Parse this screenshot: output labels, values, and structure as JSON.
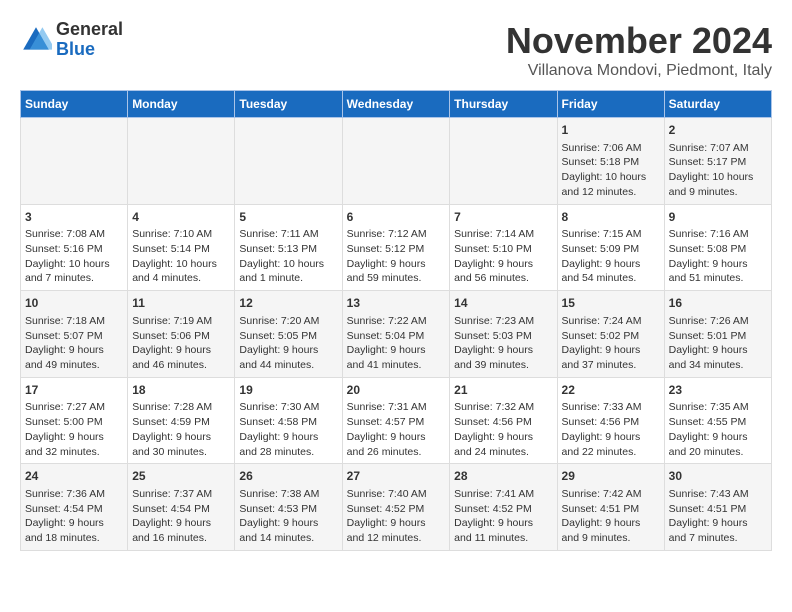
{
  "header": {
    "logo_general": "General",
    "logo_blue": "Blue",
    "month_title": "November 2024",
    "location": "Villanova Mondovi, Piedmont, Italy"
  },
  "days_of_week": [
    "Sunday",
    "Monday",
    "Tuesday",
    "Wednesday",
    "Thursday",
    "Friday",
    "Saturday"
  ],
  "weeks": [
    [
      {
        "day": "",
        "info": ""
      },
      {
        "day": "",
        "info": ""
      },
      {
        "day": "",
        "info": ""
      },
      {
        "day": "",
        "info": ""
      },
      {
        "day": "",
        "info": ""
      },
      {
        "day": "1",
        "info": "Sunrise: 7:06 AM\nSunset: 5:18 PM\nDaylight: 10 hours and 12 minutes."
      },
      {
        "day": "2",
        "info": "Sunrise: 7:07 AM\nSunset: 5:17 PM\nDaylight: 10 hours and 9 minutes."
      }
    ],
    [
      {
        "day": "3",
        "info": "Sunrise: 7:08 AM\nSunset: 5:16 PM\nDaylight: 10 hours and 7 minutes."
      },
      {
        "day": "4",
        "info": "Sunrise: 7:10 AM\nSunset: 5:14 PM\nDaylight: 10 hours and 4 minutes."
      },
      {
        "day": "5",
        "info": "Sunrise: 7:11 AM\nSunset: 5:13 PM\nDaylight: 10 hours and 1 minute."
      },
      {
        "day": "6",
        "info": "Sunrise: 7:12 AM\nSunset: 5:12 PM\nDaylight: 9 hours and 59 minutes."
      },
      {
        "day": "7",
        "info": "Sunrise: 7:14 AM\nSunset: 5:10 PM\nDaylight: 9 hours and 56 minutes."
      },
      {
        "day": "8",
        "info": "Sunrise: 7:15 AM\nSunset: 5:09 PM\nDaylight: 9 hours and 54 minutes."
      },
      {
        "day": "9",
        "info": "Sunrise: 7:16 AM\nSunset: 5:08 PM\nDaylight: 9 hours and 51 minutes."
      }
    ],
    [
      {
        "day": "10",
        "info": "Sunrise: 7:18 AM\nSunset: 5:07 PM\nDaylight: 9 hours and 49 minutes."
      },
      {
        "day": "11",
        "info": "Sunrise: 7:19 AM\nSunset: 5:06 PM\nDaylight: 9 hours and 46 minutes."
      },
      {
        "day": "12",
        "info": "Sunrise: 7:20 AM\nSunset: 5:05 PM\nDaylight: 9 hours and 44 minutes."
      },
      {
        "day": "13",
        "info": "Sunrise: 7:22 AM\nSunset: 5:04 PM\nDaylight: 9 hours and 41 minutes."
      },
      {
        "day": "14",
        "info": "Sunrise: 7:23 AM\nSunset: 5:03 PM\nDaylight: 9 hours and 39 minutes."
      },
      {
        "day": "15",
        "info": "Sunrise: 7:24 AM\nSunset: 5:02 PM\nDaylight: 9 hours and 37 minutes."
      },
      {
        "day": "16",
        "info": "Sunrise: 7:26 AM\nSunset: 5:01 PM\nDaylight: 9 hours and 34 minutes."
      }
    ],
    [
      {
        "day": "17",
        "info": "Sunrise: 7:27 AM\nSunset: 5:00 PM\nDaylight: 9 hours and 32 minutes."
      },
      {
        "day": "18",
        "info": "Sunrise: 7:28 AM\nSunset: 4:59 PM\nDaylight: 9 hours and 30 minutes."
      },
      {
        "day": "19",
        "info": "Sunrise: 7:30 AM\nSunset: 4:58 PM\nDaylight: 9 hours and 28 minutes."
      },
      {
        "day": "20",
        "info": "Sunrise: 7:31 AM\nSunset: 4:57 PM\nDaylight: 9 hours and 26 minutes."
      },
      {
        "day": "21",
        "info": "Sunrise: 7:32 AM\nSunset: 4:56 PM\nDaylight: 9 hours and 24 minutes."
      },
      {
        "day": "22",
        "info": "Sunrise: 7:33 AM\nSunset: 4:56 PM\nDaylight: 9 hours and 22 minutes."
      },
      {
        "day": "23",
        "info": "Sunrise: 7:35 AM\nSunset: 4:55 PM\nDaylight: 9 hours and 20 minutes."
      }
    ],
    [
      {
        "day": "24",
        "info": "Sunrise: 7:36 AM\nSunset: 4:54 PM\nDaylight: 9 hours and 18 minutes."
      },
      {
        "day": "25",
        "info": "Sunrise: 7:37 AM\nSunset: 4:54 PM\nDaylight: 9 hours and 16 minutes."
      },
      {
        "day": "26",
        "info": "Sunrise: 7:38 AM\nSunset: 4:53 PM\nDaylight: 9 hours and 14 minutes."
      },
      {
        "day": "27",
        "info": "Sunrise: 7:40 AM\nSunset: 4:52 PM\nDaylight: 9 hours and 12 minutes."
      },
      {
        "day": "28",
        "info": "Sunrise: 7:41 AM\nSunset: 4:52 PM\nDaylight: 9 hours and 11 minutes."
      },
      {
        "day": "29",
        "info": "Sunrise: 7:42 AM\nSunset: 4:51 PM\nDaylight: 9 hours and 9 minutes."
      },
      {
        "day": "30",
        "info": "Sunrise: 7:43 AM\nSunset: 4:51 PM\nDaylight: 9 hours and 7 minutes."
      }
    ]
  ]
}
